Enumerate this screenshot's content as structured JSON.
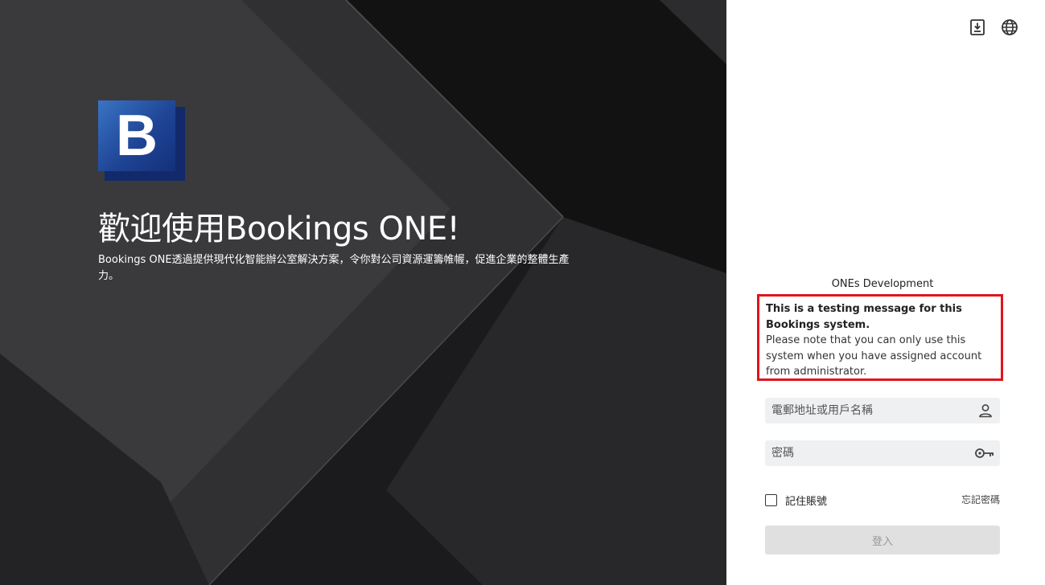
{
  "hero": {
    "logo_letter": "B",
    "welcome_title": "歡迎使用Bookings ONE!",
    "intro_text": "Bookings ONE透過提供現代化智能辦公室解決方案，令你對公司資源運籌帷幄，促進企業的整體生產力。"
  },
  "topbar": {
    "download_icon": "download-icon",
    "language_icon": "globe-icon"
  },
  "login": {
    "environment": "ONEs Development",
    "notice_bold": "This is a testing message for this Bookings system.",
    "notice_body": "Please note that you can only use this system when you have assigned account from administrator.",
    "username_placeholder": "電郵地址或用戶名稱",
    "password_placeholder": "密碼",
    "remember_label": "記住賬號",
    "forgot_label": "忘記密碼",
    "login_label": "登入"
  },
  "colors": {
    "notice_border": "#e0141c",
    "logo_blue": "#1f4596",
    "button_disabled": "#e0e0e0"
  }
}
